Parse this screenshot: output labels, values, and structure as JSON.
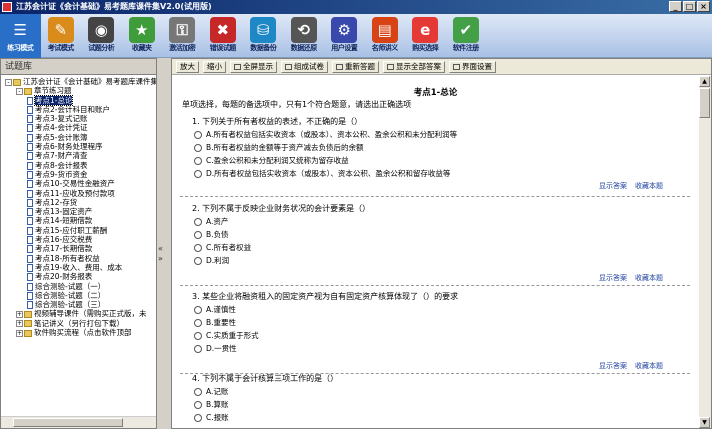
{
  "window": {
    "title": "江苏会计证《会计基础》易考题库课件集V2.0(试用版)",
    "controls": [
      "_",
      "□",
      "×"
    ]
  },
  "toolbar": [
    {
      "label": "练习模式",
      "icon": "mode-icon",
      "color": "#2a6fc7"
    },
    {
      "label": "考试模式",
      "icon": "exam-icon",
      "color": "#d98b1c"
    },
    {
      "label": "试题分析",
      "icon": "analysis-icon",
      "color": "#444"
    },
    {
      "label": "收藏夹",
      "icon": "bookmark-icon",
      "color": "#3e9c3a"
    },
    {
      "label": "激活加密",
      "icon": "activate-icon",
      "color": "#777"
    },
    {
      "label": "错误试题",
      "icon": "error-icon",
      "color": "#c62828"
    },
    {
      "label": "数据备份",
      "icon": "backup-icon",
      "color": "#1e88c7"
    },
    {
      "label": "数据还原",
      "icon": "restore-icon",
      "color": "#555"
    },
    {
      "label": "用户设置",
      "icon": "user-settings-icon",
      "color": "#3949ab"
    },
    {
      "label": "名师讲义",
      "icon": "lecture-icon",
      "color": "#d84315"
    },
    {
      "label": "购买选择",
      "icon": "ie-icon",
      "color": "#e53935"
    },
    {
      "label": "软件注册",
      "icon": "register-icon",
      "color": "#43a047"
    }
  ],
  "sidebar": {
    "title": "试题库",
    "tree": [
      {
        "text": "江苏会计证《会计基础》易考题库课件集",
        "level": 0,
        "type": "folder",
        "box": "-"
      },
      {
        "text": "章节练习题",
        "level": 1,
        "type": "folder",
        "box": "-"
      },
      {
        "text": "考点1-总论",
        "level": 2,
        "type": "page",
        "selected": true
      },
      {
        "text": "考点2-会计科目和账户",
        "level": 2,
        "type": "page"
      },
      {
        "text": "考点3-复式记账",
        "level": 2,
        "type": "page"
      },
      {
        "text": "考点4-会计凭证",
        "level": 2,
        "type": "page"
      },
      {
        "text": "考点5-会计账簿",
        "level": 2,
        "type": "page"
      },
      {
        "text": "考点6-财务处理程序",
        "level": 2,
        "type": "page"
      },
      {
        "text": "考点7-财产清查",
        "level": 2,
        "type": "page"
      },
      {
        "text": "考点8-会计报表",
        "level": 2,
        "type": "page"
      },
      {
        "text": "考点9-货币资金",
        "level": 2,
        "type": "page"
      },
      {
        "text": "考点10-交易性金融资产",
        "level": 2,
        "type": "page"
      },
      {
        "text": "考点11-应收及预付款项",
        "level": 2,
        "type": "page"
      },
      {
        "text": "考点12-存货",
        "level": 2,
        "type": "page"
      },
      {
        "text": "考点13-固定资产",
        "level": 2,
        "type": "page"
      },
      {
        "text": "考点14-短期借款",
        "level": 2,
        "type": "page"
      },
      {
        "text": "考点15-应付职工薪酬",
        "level": 2,
        "type": "page"
      },
      {
        "text": "考点16-应交税费",
        "level": 2,
        "type": "page"
      },
      {
        "text": "考点17-长期借款",
        "level": 2,
        "type": "page"
      },
      {
        "text": "考点18-所有者权益",
        "level": 2,
        "type": "page"
      },
      {
        "text": "考点19-收入、费用、成本",
        "level": 2,
        "type": "page"
      },
      {
        "text": "考点20-财务报表",
        "level": 2,
        "type": "page"
      },
      {
        "text": "综合测验-试题（一）",
        "level": 2,
        "type": "page"
      },
      {
        "text": "综合测验-试题（二）",
        "level": 2,
        "type": "page"
      },
      {
        "text": "综合测验-试题（三）",
        "level": 2,
        "type": "page"
      },
      {
        "text": "视频辅导课件（需购买正式版，未",
        "level": 1,
        "type": "folder",
        "box": "+"
      },
      {
        "text": "笔记讲义（另行打包下载）",
        "level": 1,
        "type": "folder",
        "box": "+"
      },
      {
        "text": "软件购买流程（点击软件顶部",
        "level": 1,
        "type": "folder",
        "box": "+"
      }
    ]
  },
  "main_toolbar": [
    {
      "label": "放大",
      "icon": ""
    },
    {
      "label": "缩小",
      "icon": ""
    },
    {
      "label": "全屏显示",
      "icon": "fullscreen-icon"
    },
    {
      "label": "组成试卷",
      "icon": "compose-icon"
    },
    {
      "label": "重新答题",
      "icon": "redo-icon"
    },
    {
      "label": "显示全部答案",
      "icon": "answers-icon"
    },
    {
      "label": "界面设置",
      "icon": "settings-icon"
    }
  ],
  "content": {
    "heading": "考点1-总论",
    "instruction": "单项选择，每题的备选项中，只有1个符合题意，请选出正确选项",
    "links": {
      "show_answer": "显示答案",
      "bookmark": "收藏本题"
    },
    "questions": [
      {
        "text": "1. 下列关于所有者权益的表述，不正确的是（）",
        "options": [
          "A.所有者权益包括实收资本（或股本）、资本公积、盈余公积和未分配利润等",
          "B.所有者权益的金额等于资产减去负债后的余额",
          "C.盈余公积和未分配利润又统称为留存收益",
          "D.所有者权益包括实收资本（或股本）、资本公积、盈余公积和留存收益等"
        ]
      },
      {
        "text": "2. 下列不属于反映企业财务状况的会计要素是（）",
        "options": [
          "A.资产",
          "B.负债",
          "C.所有者权益",
          "D.利润"
        ]
      },
      {
        "text": "3. 某些企业将融资租入的固定资产视为自有固定资产核算体现了（）的要求",
        "options": [
          "A.谨慎性",
          "B.重要性",
          "C.实质重于形式",
          "D.一贯性"
        ]
      },
      {
        "text": "4. 下列不属于会计核算三项工作的是（）",
        "options": [
          "A.记账",
          "B.算账",
          "C.报账"
        ]
      }
    ]
  }
}
